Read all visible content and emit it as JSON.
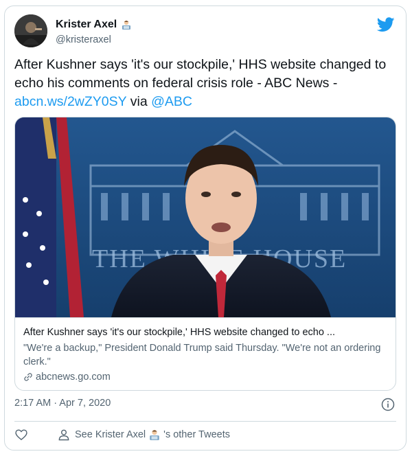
{
  "user": {
    "display_name": "Krister Axel",
    "handle": "@kristeraxel",
    "verified_emoji": "technologist-emoji"
  },
  "tweet": {
    "text_main": "After Kushner says 'it's our stockpile,' HHS website changed to echo his comments on federal crisis role  - ABC News - ",
    "link": "abcn.ws/2wZY0SY",
    "via": " via ",
    "mention": "@ABC"
  },
  "preview": {
    "title": "After Kushner says 'it's our stockpile,' HHS website changed to echo ...",
    "description": "\"We're a backup,\" President Donald Trump said Thursday. \"We're not an ordering clerk.\"",
    "domain": "abcnews.go.com",
    "image_text": "THE WHITE HOUSE"
  },
  "timestamp": "2:17 AM · Apr 7, 2020",
  "actions": {
    "see_tweets_prefix": "See Krister Axel",
    "see_tweets_suffix": "'s other Tweets"
  },
  "colors": {
    "link": "#1d9bf0",
    "twitter_blue": "#1d9bf0",
    "secondary_text": "#536471",
    "border": "#cfd9de"
  }
}
